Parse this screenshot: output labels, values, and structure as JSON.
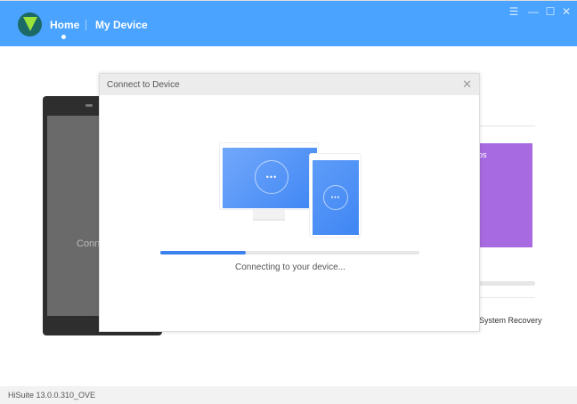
{
  "header": {
    "tabs": [
      {
        "label": "Home",
        "active": true
      },
      {
        "label": "My Device"
      }
    ],
    "window_controls": [
      "menu-icon",
      "minimize-icon",
      "maximize-icon",
      "close-icon"
    ]
  },
  "background": {
    "phone_text": "Conn",
    "card_text": "os",
    "system_recovery": "System Recovery"
  },
  "dialog": {
    "title": "Connect to Device",
    "progress_percent": 33,
    "status": "Connecting to your device...",
    "accent": "#3b82f0"
  },
  "statusbar": {
    "version": "HiSuite 13.0.0.310_OVE"
  }
}
